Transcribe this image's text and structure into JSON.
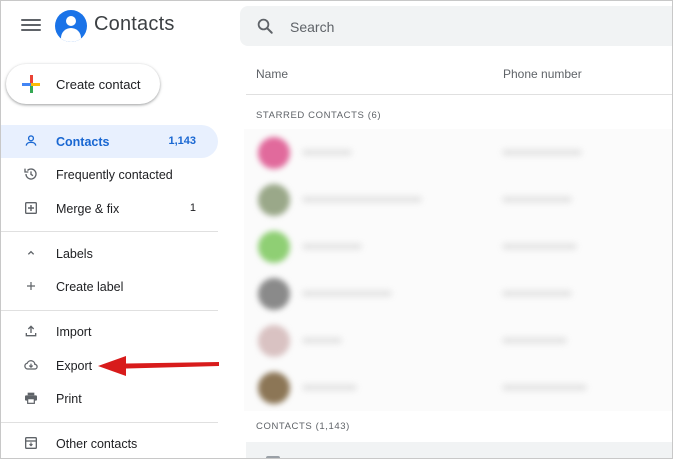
{
  "header": {
    "app_title": "Contacts",
    "search_placeholder": "Search"
  },
  "create_button_label": "Create contact",
  "sidebar": {
    "items": [
      {
        "label": "Contacts",
        "count": "1,143",
        "icon": "person-icon",
        "active": true
      },
      {
        "label": "Frequently contacted",
        "count": "",
        "icon": "history-icon"
      },
      {
        "label": "Merge & fix",
        "count": "1",
        "icon": "merge-fix-icon"
      },
      {
        "label": "Labels",
        "count": "",
        "icon": "chevron-up-icon"
      },
      {
        "label": "Create label",
        "count": "",
        "icon": "plus-icon"
      },
      {
        "label": "Import",
        "count": "",
        "icon": "upload-icon"
      },
      {
        "label": "Export",
        "count": "",
        "icon": "cloud-download-icon"
      },
      {
        "label": "Print",
        "count": "",
        "icon": "printer-icon"
      },
      {
        "label": "Other contacts",
        "count": "",
        "icon": "archive-icon"
      }
    ]
  },
  "table": {
    "col_name": "Name",
    "col_phone": "Phone number",
    "starred_label": "STARRED CONTACTS (6)",
    "contacts_label": "CONTACTS (1,143)"
  },
  "colors": {
    "accent": "#1a73e8",
    "active_bg": "#e8f0fe",
    "arrow": "#d81b1b"
  }
}
